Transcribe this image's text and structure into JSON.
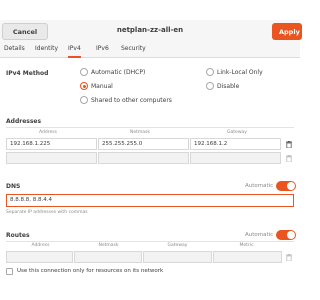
{
  "header": {
    "cancel_label": "Cancel",
    "title": "netplan-zz-all-en",
    "apply_label": "Apply"
  },
  "tabs": [
    {
      "label": "Details"
    },
    {
      "label": "Identity"
    },
    {
      "label": "IPv4"
    },
    {
      "label": "IPv6"
    },
    {
      "label": "Security"
    }
  ],
  "ipv4": {
    "method_label": "IPv4 Method",
    "options": [
      {
        "label": "Automatic (DHCP)",
        "selected": false
      },
      {
        "label": "Link-Local Only",
        "selected": false
      },
      {
        "label": "Manual",
        "selected": true
      },
      {
        "label": "Disable",
        "selected": false
      },
      {
        "label": "Shared to other computers",
        "selected": false
      }
    ]
  },
  "addresses": {
    "label": "Addresses",
    "columns": [
      "Address",
      "Netmask",
      "Gateway"
    ],
    "rows": [
      {
        "address": "192.168.1.225",
        "netmask": "255.255.255.0",
        "gateway": "192.168.1.2"
      },
      {
        "address": "",
        "netmask": "",
        "gateway": ""
      }
    ]
  },
  "dns": {
    "label": "DNS",
    "automatic_label": "Automatic",
    "automatic_on": true,
    "value": "8.8.8.8, 8.8.4.4",
    "hint": "Separate IP addresses with commas"
  },
  "routes": {
    "label": "Routes",
    "automatic_label": "Automatic",
    "automatic_on": true,
    "columns": [
      "Address",
      "Netmask",
      "Gateway",
      "Metric"
    ],
    "footer": "Use this connection only for resources on its network"
  },
  "colors": {
    "accent": "#e95420",
    "window_bg": "#ffffff",
    "header_bg": "#f6f6f6"
  }
}
